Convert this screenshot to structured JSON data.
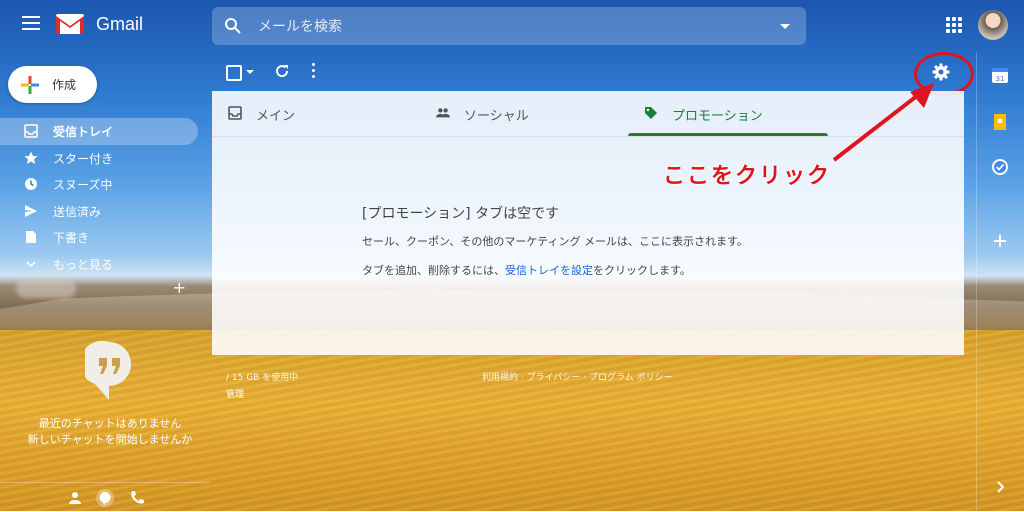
{
  "app": {
    "brand": "Gmail"
  },
  "search": {
    "placeholder": "メールを検索"
  },
  "compose": {
    "label": "作成"
  },
  "nav": [
    {
      "label": "受信トレイ",
      "icon": "inbox-icon",
      "active": true
    },
    {
      "label": "スター付き",
      "icon": "star-icon"
    },
    {
      "label": "スヌーズ中",
      "icon": "clock-icon"
    },
    {
      "label": "送信済み",
      "icon": "send-icon"
    },
    {
      "label": "下書き",
      "icon": "draft-icon"
    },
    {
      "label": "もっと見る",
      "icon": "chevron-down-icon"
    }
  ],
  "chat": {
    "empty_line1": "最近のチャットはありません",
    "empty_line2": "新しいチャットを開始しませんか"
  },
  "tabs": [
    {
      "label": "メイン",
      "icon": "inbox-icon"
    },
    {
      "label": "ソーシャル",
      "icon": "people-icon"
    },
    {
      "label": "プロモーション",
      "icon": "tag-icon",
      "active": true
    }
  ],
  "empty": {
    "title": "[プロモーション] タブは空です",
    "line1": "セール、クーポン、その他のマーケティング メールは、ここに表示されます。",
    "line2_prefix": "タブを追加、削除するには、",
    "line2_link": "受信トレイを設定",
    "line2_suffix": "をクリックします。"
  },
  "footer": {
    "usage": "/ 15 GB を使用中",
    "manage": "管理",
    "terms": "利用規約",
    "privacy": "プライバシー",
    "policy": "プログラム ポリシー"
  },
  "annotation": {
    "text": "ここをクリック",
    "color": "#e0141e"
  },
  "colors": {
    "accent_green": "#188038",
    "link_blue": "#1a5fd0"
  }
}
